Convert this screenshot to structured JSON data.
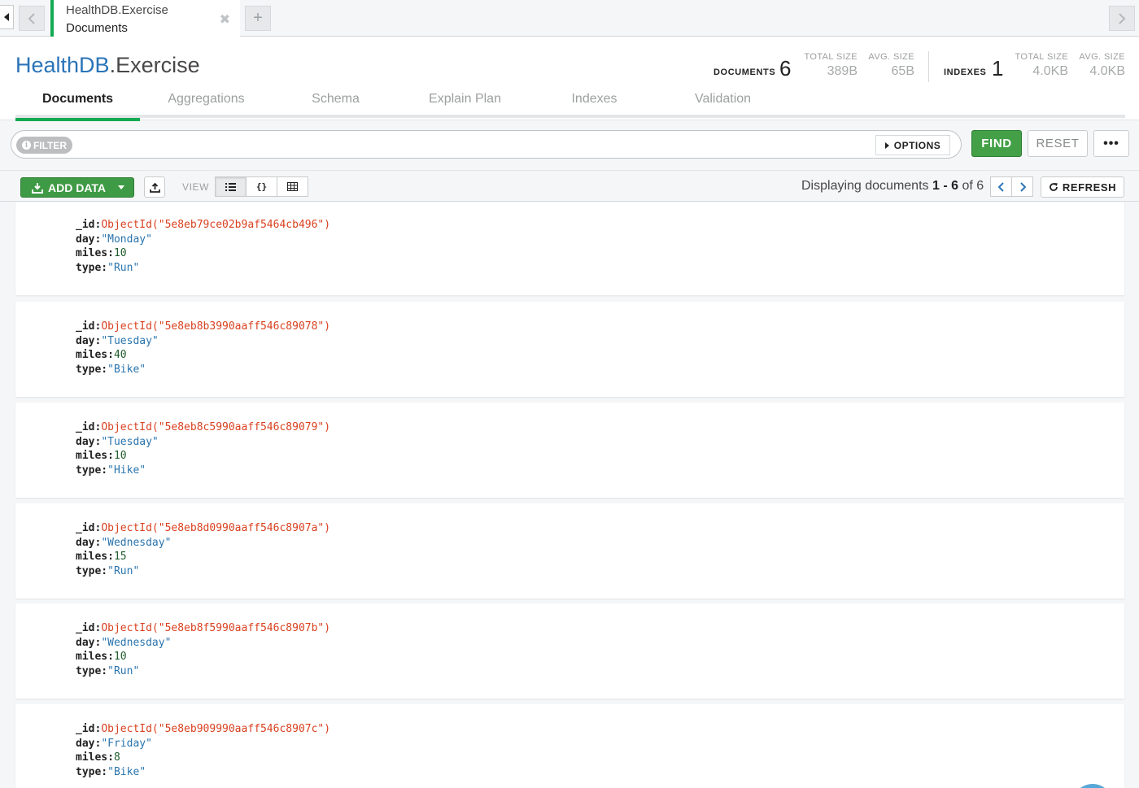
{
  "tab": {
    "title": "HealthDB.Exercise",
    "subtitle": "Documents",
    "close": "✖",
    "new_tab": "+"
  },
  "header": {
    "db": "HealthDB",
    "collection": ".Exercise",
    "documents_label": "DOCUMENTS",
    "documents_count": "6",
    "doc_total_size_label": "TOTAL SIZE",
    "doc_total_size": "389B",
    "doc_avg_size_label": "AVG. SIZE",
    "doc_avg_size": "65B",
    "indexes_label": "INDEXES",
    "indexes_count": "1",
    "idx_total_size_label": "TOTAL SIZE",
    "idx_total_size": "4.0KB",
    "idx_avg_size_label": "AVG. SIZE",
    "idx_avg_size": "4.0KB"
  },
  "subtabs": [
    "Documents",
    "Aggregations",
    "Schema",
    "Explain Plan",
    "Indexes",
    "Validation"
  ],
  "querybar": {
    "filter_label": "FILTER",
    "options_label": "OPTIONS",
    "find_label": "FIND",
    "reset_label": "RESET",
    "more_label": "•••"
  },
  "toolbar": {
    "add_data_label": "ADD DATA",
    "view_label": "VIEW",
    "display_prefix": "Displaying documents ",
    "display_start": "1",
    "display_dash": " - ",
    "display_end": "6",
    "display_of": " of ",
    "display_total": "6",
    "refresh_label": "REFRESH"
  },
  "documents": [
    {
      "id": "ObjectId(\"5e8eb79ce02b9af5464cb496\")",
      "day": "\"Monday\"",
      "miles": "10",
      "type": "\"Run\""
    },
    {
      "id": "ObjectId(\"5e8eb8b3990aaff546c89078\")",
      "day": "\"Tuesday\"",
      "miles": "40",
      "type": "\"Bike\""
    },
    {
      "id": "ObjectId(\"5e8eb8c5990aaff546c89079\")",
      "day": "\"Tuesday\"",
      "miles": "10",
      "type": "\"Hike\""
    },
    {
      "id": "ObjectId(\"5e8eb8d0990aaff546c8907a\")",
      "day": "\"Wednesday\"",
      "miles": "15",
      "type": "\"Run\""
    },
    {
      "id": "ObjectId(\"5e8eb8f5990aaff546c8907b\")",
      "day": "\"Wednesday\"",
      "miles": "10",
      "type": "\"Run\""
    },
    {
      "id": "ObjectId(\"5e8eb909990aaff546c8907c\")",
      "day": "\"Friday\"",
      "miles": "8",
      "type": "\"Bike\""
    }
  ],
  "field_keys": {
    "id": "_id:",
    "day": "day:",
    "miles": "miles:",
    "type": "type:"
  }
}
